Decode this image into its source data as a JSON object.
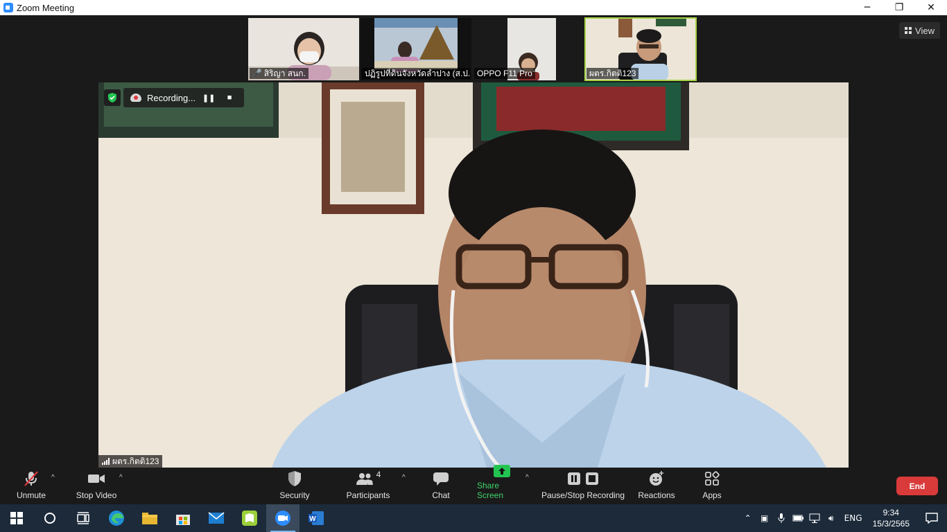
{
  "window": {
    "title": "Zoom Meeting",
    "controls": {
      "minimize": "─",
      "restore": "❐",
      "close": "✕"
    }
  },
  "view_button": {
    "label": "View"
  },
  "thumbnails": [
    {
      "name": "สิริญา สนก.",
      "muted": true
    },
    {
      "name": "ปฏิรูปที่ดินจังหวัดลำปาง (ส.ป....",
      "muted": false
    },
    {
      "name": "OPPO F11 Pro",
      "muted": false
    },
    {
      "name": "ผตร.กิตติ123",
      "muted": false,
      "active": true
    }
  ],
  "recording": {
    "label": "Recording...",
    "pause": "❚❚",
    "stop": "■"
  },
  "main_video": {
    "name": "ผตร.กิตติ123"
  },
  "toolbar": {
    "unmute": "Unmute",
    "stop_video": "Stop Video",
    "security": "Security",
    "participants": "Participants",
    "participants_count": "4",
    "chat": "Chat",
    "share_screen": "Share Screen",
    "pause_stop_recording": "Pause/Stop Recording",
    "reactions": "Reactions",
    "apps": "Apps",
    "end": "End",
    "caret": "^"
  },
  "taskbar": {
    "language": "ENG",
    "time": "9:34",
    "date": "15/3/2565"
  },
  "colors": {
    "accent_green": "#a7d345",
    "share_green": "#3fd36b",
    "end_red": "#d93a3a",
    "zoom_blue": "#2d8cff"
  }
}
